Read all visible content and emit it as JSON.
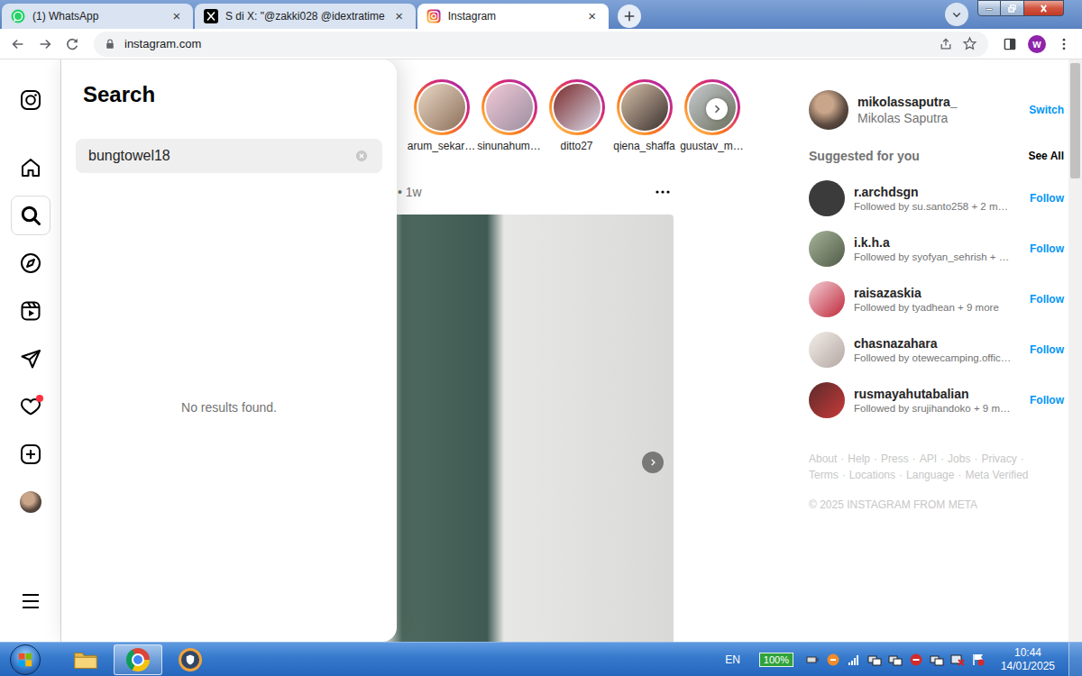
{
  "browser": {
    "tabs": [
      {
        "kind": "whatsapp",
        "title": "(1) WhatsApp",
        "selected": false
      },
      {
        "kind": "x",
        "title": "S di X: \"@zakki028 @idextratime",
        "selected": false
      },
      {
        "kind": "instagram",
        "title": "Instagram",
        "selected": true
      }
    ],
    "tab_close": "×",
    "address": "instagram.com",
    "profile_initial": "w"
  },
  "instagram": {
    "nav": [
      {
        "kind": "home",
        "selected": false,
        "dot": false
      },
      {
        "kind": "search",
        "selected": true,
        "dot": false
      },
      {
        "kind": "explore",
        "selected": false,
        "dot": false
      },
      {
        "kind": "reels",
        "selected": false,
        "dot": false
      },
      {
        "kind": "messages",
        "selected": false,
        "dot": false
      },
      {
        "kind": "notifications",
        "selected": false,
        "dot": true
      },
      {
        "kind": "create",
        "selected": false,
        "dot": false
      },
      {
        "kind": "profile",
        "selected": false,
        "dot": false
      }
    ],
    "search": {
      "title": "Search",
      "query": "bungtowel18",
      "empty_message": "No results found."
    },
    "stories": [
      {
        "label": "arum_sekar…"
      },
      {
        "label": "sinunahum…"
      },
      {
        "label": "ditto27"
      },
      {
        "label": "qiena_shaffa"
      },
      {
        "label": "guustav_m…"
      }
    ],
    "post": {
      "separator": "•",
      "time": "1w"
    },
    "account": {
      "username": "mikolassaputra_",
      "name": "Mikolas Saputra",
      "action": "Switch"
    },
    "suggestions": {
      "title": "Suggested for you",
      "see_all": "See All",
      "items": [
        {
          "username": "r.archdsgn",
          "subtitle": "Followed by su.santo258 + 2 m…",
          "action": "Follow"
        },
        {
          "username": "i.k.h.a",
          "subtitle": "Followed by syofyan_sehrish + …",
          "action": "Follow"
        },
        {
          "username": "raisazaskia",
          "subtitle": "Followed by tyadhean + 9 more",
          "action": "Follow"
        },
        {
          "username": "chasnazahara",
          "subtitle": "Followed by otewecamping.offic…",
          "action": "Follow"
        },
        {
          "username": "rusmayahutabalian",
          "subtitle": "Followed by srujihandoko + 9 m…",
          "action": "Follow"
        }
      ]
    },
    "footer": {
      "links": [
        "About",
        "Help",
        "Press",
        "API",
        "Jobs",
        "Privacy",
        "Terms",
        "Locations",
        "Language",
        "Meta Verified"
      ],
      "separator": "·",
      "copyright": "© 2025 INSTAGRAM FROM META"
    }
  },
  "scrollbar": {
    "level": 0.2
  },
  "taskbar": {
    "apps": [
      {
        "kind": "explorer",
        "selected": false
      },
      {
        "kind": "chrome",
        "selected": true
      },
      {
        "kind": "vpn",
        "selected": false
      }
    ],
    "language": "EN",
    "battery": "100%",
    "time": "10:44",
    "date": "14/01/2025"
  }
}
